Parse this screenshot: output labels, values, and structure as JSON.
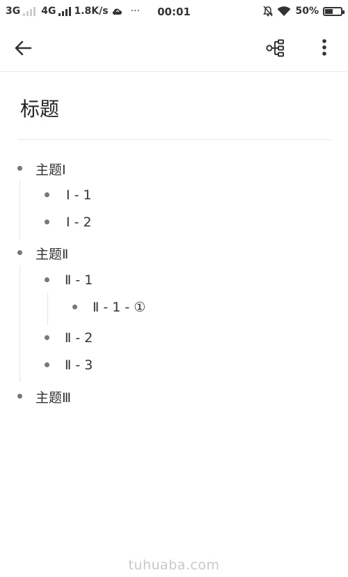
{
  "status_bar": {
    "network_1": "3G",
    "network_2": "4G",
    "speed": "1.8K/s",
    "more": "···",
    "time": "00:01",
    "battery": "50%",
    "battery_level": 0.5
  },
  "app_bar": {
    "back_icon": "arrow-left-icon",
    "mindmap_icon": "mind-map-icon",
    "more_icon": "more-vertical-icon"
  },
  "document": {
    "title": "标题",
    "topic_1": "主题Ⅰ",
    "topic_1_1": "Ⅰ - 1",
    "topic_1_2": "Ⅰ - 2",
    "topic_2": "主题Ⅱ",
    "topic_2_1": "Ⅱ - 1",
    "topic_2_1_1": "Ⅱ - 1 - ①",
    "topic_2_2": "Ⅱ - 2",
    "topic_2_3": "Ⅱ - 3",
    "topic_3": "主题Ⅲ"
  },
  "watermark": "tuhuaba.com"
}
